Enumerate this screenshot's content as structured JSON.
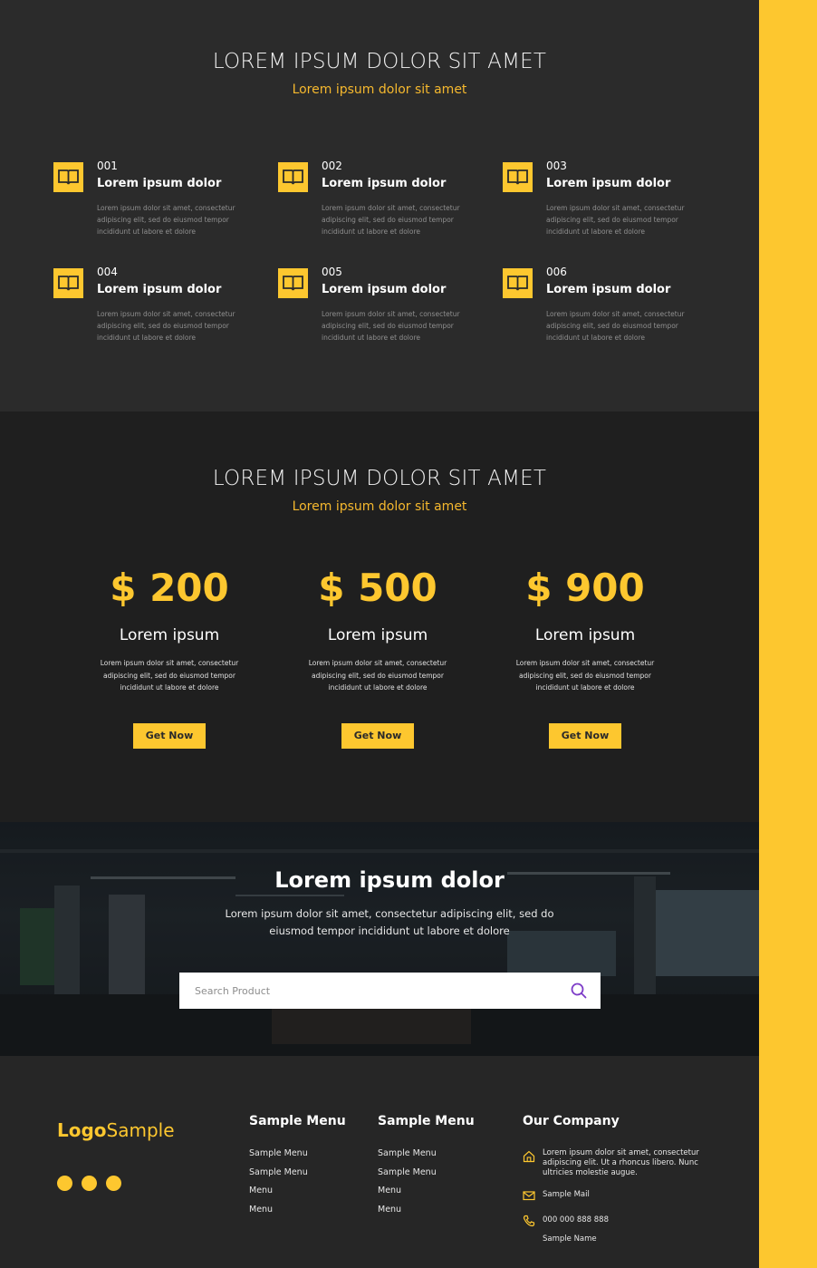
{
  "colors": {
    "accent": "#fdc72f",
    "dark": "#2b2b2b",
    "darker": "#1f1f1f",
    "footer": "#262626"
  },
  "features": {
    "title": "LOREM IPSUM DOLOR SIT AMET",
    "subtitle": "Lorem ipsum dolor sit amet",
    "items": [
      {
        "icon": "book-icon",
        "number": "001",
        "title": "Lorem ipsum dolor",
        "desc": "Lorem ipsum dolor sit amet, consectetur adipiscing elit, sed do eiusmod tempor incididunt ut labore et dolore"
      },
      {
        "icon": "book-icon",
        "number": "002",
        "title": "Lorem ipsum dolor",
        "desc": "Lorem ipsum dolor sit amet, consectetur adipiscing elit, sed do eiusmod tempor incididunt ut labore et dolore"
      },
      {
        "icon": "book-icon",
        "number": "003",
        "title": "Lorem ipsum dolor",
        "desc": "Lorem ipsum dolor sit amet, consectetur adipiscing elit, sed do eiusmod tempor incididunt ut labore et dolore"
      },
      {
        "icon": "book-icon",
        "number": "004",
        "title": "Lorem ipsum dolor",
        "desc": "Lorem ipsum dolor sit amet, consectetur adipiscing elit, sed do eiusmod tempor incididunt ut labore et dolore"
      },
      {
        "icon": "book-icon",
        "number": "005",
        "title": "Lorem ipsum dolor",
        "desc": "Lorem ipsum dolor sit amet, consectetur adipiscing elit, sed do eiusmod tempor incididunt ut labore et dolore"
      },
      {
        "icon": "book-icon",
        "number": "006",
        "title": "Lorem ipsum dolor",
        "desc": "Lorem ipsum dolor sit amet, consectetur adipiscing elit, sed do eiusmod tempor incididunt ut labore et dolore"
      }
    ]
  },
  "pricing": {
    "title": "LOREM IPSUM DOLOR SIT AMET",
    "subtitle": "Lorem ipsum dolor sit amet",
    "plans": [
      {
        "price": "$ 200",
        "name": "Lorem ipsum",
        "desc": "Lorem ipsum dolor sit amet, consectetur adipiscing elit, sed do eiusmod tempor incididunt ut labore et dolore",
        "button": "Get Now"
      },
      {
        "price": "$ 500",
        "name": "Lorem ipsum",
        "desc": "Lorem ipsum dolor sit amet, consectetur adipiscing elit, sed do eiusmod tempor incididunt ut labore et dolore",
        "button": "Get Now"
      },
      {
        "price": "$ 900",
        "name": "Lorem ipsum",
        "desc": "Lorem ipsum dolor sit amet, consectetur adipiscing elit, sed do eiusmod tempor incididunt ut labore et dolore",
        "button": "Get Now"
      }
    ]
  },
  "hero": {
    "title": "Lorem ipsum dolor",
    "desc": "Lorem ipsum dolor sit amet, consectetur adipiscing elit, sed do eiusmod tempor incididunt ut labore et dolore",
    "search_placeholder": "Search Product",
    "search_icon": "search-icon"
  },
  "footer": {
    "logo_bold": "Logo",
    "logo_light": "Sample",
    "menus": [
      {
        "heading": "Sample Menu",
        "links": [
          "Sample Menu",
          "Sample Menu",
          "Menu",
          "Menu"
        ]
      },
      {
        "heading": "Sample Menu",
        "links": [
          "Sample Menu",
          "Sample Menu",
          "Menu",
          "Menu"
        ]
      }
    ],
    "company": {
      "heading": "Our Company",
      "address_lines": [
        "Lorem ipsum dolor sit amet, consectetur",
        "adipiscing elit. Ut a rhoncus libero. Nunc",
        "ultricies molestie augue."
      ],
      "mail": "Sample Mail",
      "phone": "000 000 888 888",
      "name": "Sample Name"
    }
  }
}
